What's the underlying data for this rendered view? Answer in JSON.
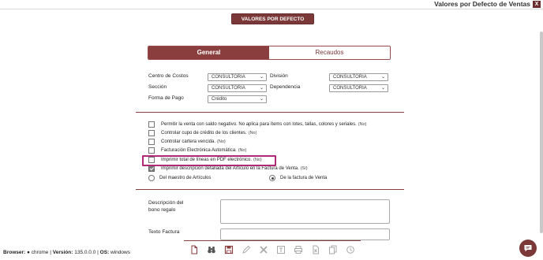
{
  "window": {
    "title": "Valores por Defecto de Ventas",
    "close_label": "X"
  },
  "defaults_button": "VALORES POR DEFECTO",
  "tabs": [
    {
      "label": "General",
      "active": true
    },
    {
      "label": "Recaudos",
      "active": false
    }
  ],
  "form": {
    "centro_costos": {
      "label": "Centro de Costos",
      "value": "CONSULTORIA"
    },
    "division": {
      "label": "División",
      "value": "CONSULTORIA"
    },
    "seccion": {
      "label": "Sección",
      "value": "CONSULTORIA"
    },
    "dependencia": {
      "label": "Dependencia",
      "value": "CONSULTORIA"
    },
    "forma_pago": {
      "label": "Forma de Pago",
      "value": "Crédito"
    }
  },
  "options": [
    {
      "text": "Permitir la venta con saldo negativo. No aplica para ítems con lotes, tallas, colores y seriales.",
      "note": "(No)",
      "checked": false
    },
    {
      "text": "Controlar cupo de crédito de los clientes.",
      "note": "(No)",
      "checked": false
    },
    {
      "text": "Controlar cartera vencida.",
      "note": "(No)",
      "checked": false
    },
    {
      "text": "Facturación Electrónica Automática.",
      "note": "(No)",
      "checked": false
    },
    {
      "text": "Imprimir total de líneas en PDF electrónico.",
      "note": "(No)",
      "checked": false
    },
    {
      "text": "Imprimir descripción detallada del Artículo en la Factura de Venta.",
      "note": "(Sí)",
      "checked": true
    }
  ],
  "radios": [
    {
      "label": "Del maestro de Artículos",
      "selected": false
    },
    {
      "label": "De la factura de Venta",
      "selected": true
    }
  ],
  "fields": {
    "descripcion_bono": {
      "label_line1": "Descripción del",
      "label_line2": "bono regalo"
    },
    "texto_factura": {
      "label": "Texto Factura"
    }
  },
  "toolbar": [
    "new-doc-icon",
    "binoculars-icon",
    "save-icon",
    "edit-icon",
    "delete-icon",
    "text-icon",
    "print-icon",
    "excel-icon",
    "copy-icon",
    "history-icon"
  ],
  "status": {
    "browser_label": "Browser:",
    "browser_value": "chrome",
    "version_label": "Versión:",
    "version_value": "135.0.0.0",
    "os_label": "OS:",
    "os_value": "windows"
  },
  "colors": {
    "accent": "#7b3838",
    "highlight": "#b0287a"
  }
}
